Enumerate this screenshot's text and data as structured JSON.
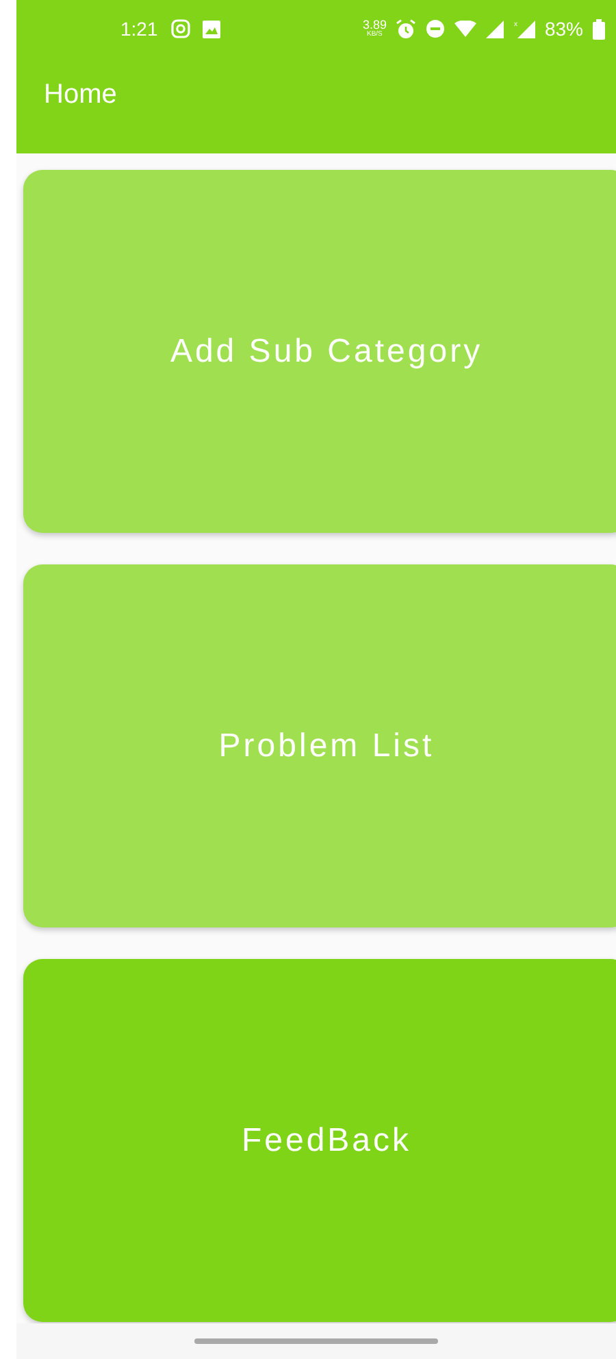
{
  "status_bar": {
    "time": "1:21",
    "speed": "3.89",
    "speed_unit": "KB/S",
    "mobile_x": "x",
    "battery": "83%"
  },
  "app_bar": {
    "title": "Home"
  },
  "cards": [
    {
      "label": "Add Sub Category",
      "color": "#a0e050"
    },
    {
      "label": "Problem List",
      "color": "#a0e050"
    },
    {
      "label": "FeedBack",
      "color": "#80d418"
    }
  ]
}
